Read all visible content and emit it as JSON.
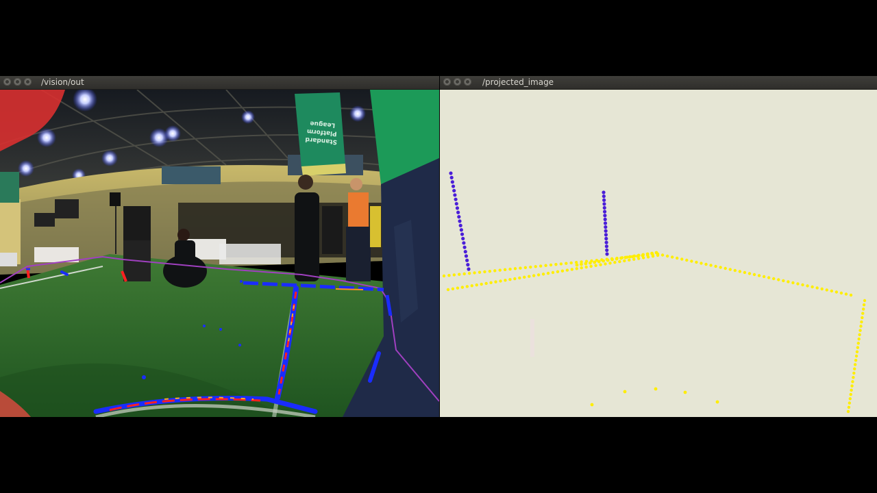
{
  "windows": [
    {
      "title": "/vision/out",
      "controls": [
        "close-icon",
        "minimize-icon",
        "maximize-icon"
      ]
    },
    {
      "title": "/projected_image",
      "controls": [
        "close-icon",
        "minimize-icon",
        "maximize-icon"
      ]
    }
  ],
  "banner_text": [
    "Standard",
    "Platform",
    "League"
  ],
  "colors": {
    "titlebar": "#3a3935",
    "projected_background": "#e6e6d5",
    "field_green": "#2f6a2a",
    "boundary_line": "#a040c0",
    "line_points": "#ffee00",
    "post_points": "#4a1ed8",
    "line_detection_blue": "#1a2cff",
    "line_detection_red": "#ff2020"
  }
}
